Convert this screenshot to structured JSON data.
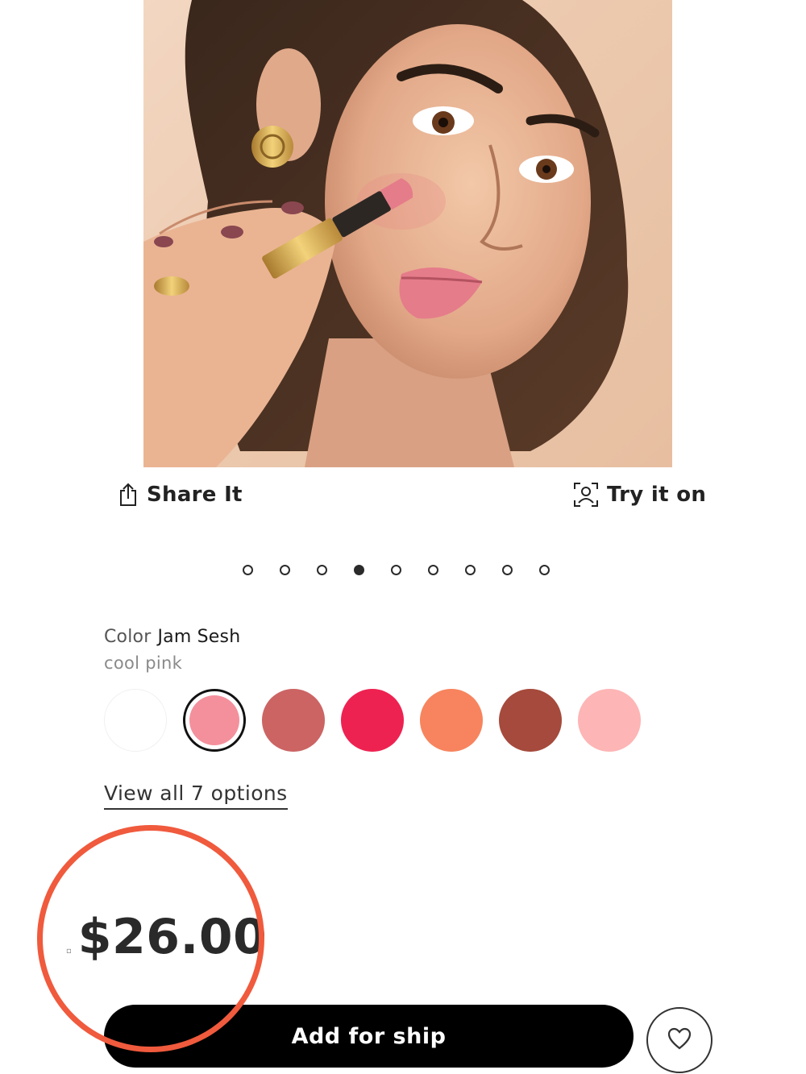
{
  "actions": {
    "share_label": "Share It",
    "try_on_label": "Try it on"
  },
  "carousel": {
    "total": 9,
    "active_index": 3
  },
  "color": {
    "label": "Color",
    "selected_name": "Jam Sesh",
    "description": "cool pink",
    "swatches": [
      {
        "color": "#ffffff",
        "selected": false
      },
      {
        "color": "#f4909c",
        "selected": true
      },
      {
        "color": "#cc6464",
        "selected": false
      },
      {
        "color": "#ee2251",
        "selected": false
      },
      {
        "color": "#f7845e",
        "selected": false
      },
      {
        "color": "#a54a3c",
        "selected": false
      },
      {
        "color": "#fdb5b5",
        "selected": false
      }
    ],
    "view_all_label": "View all 7 options"
  },
  "price": {
    "value": "$26.00",
    "highlight_color": "#f05a3d"
  },
  "buttons": {
    "add_label": "Add for ship",
    "favorite_icon": "heart-icon"
  },
  "icons": {
    "share": "share-icon",
    "try_on": "face-scan-icon"
  }
}
